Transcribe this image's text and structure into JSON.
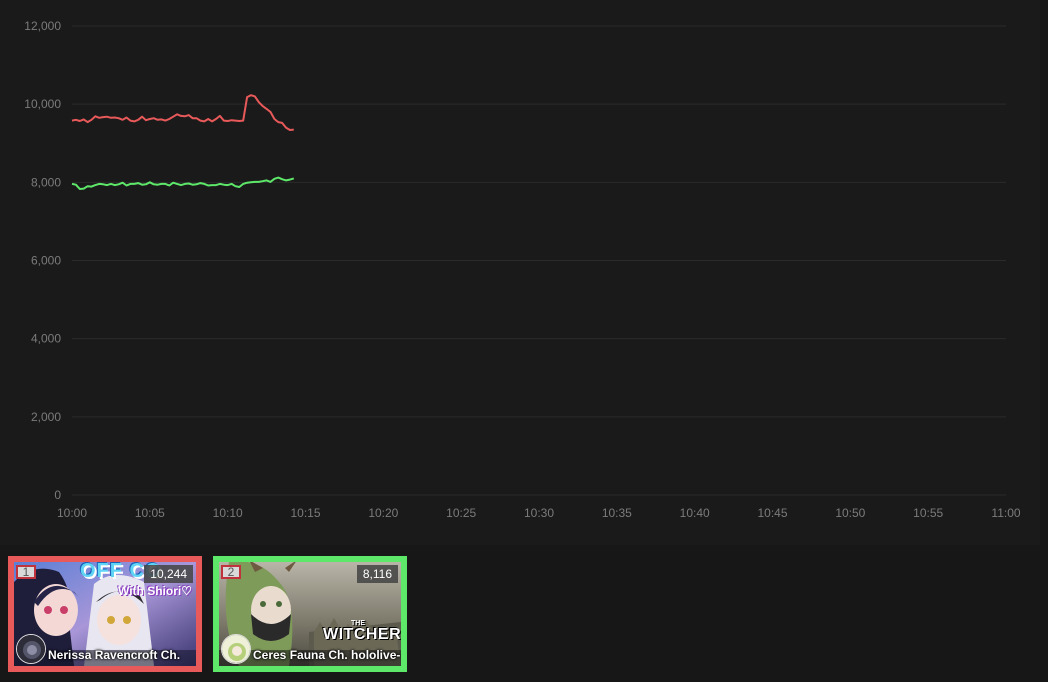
{
  "chart_data": {
    "type": "line",
    "title": "",
    "xlabel": "",
    "ylabel": "",
    "ylim": [
      0,
      12000
    ],
    "yticks": [
      "0",
      "2,000",
      "4,000",
      "6,000",
      "8,000",
      "10,000",
      "12,000"
    ],
    "xticks": [
      "10:00",
      "10:05",
      "10:10",
      "10:15",
      "10:20",
      "10:25",
      "10:30",
      "10:35",
      "10:40",
      "10:45",
      "10:50",
      "10:55",
      "11:00"
    ],
    "grid": true,
    "series": [
      {
        "color": "#e8595a",
        "points": [
          [
            0,
            9580
          ],
          [
            0.25,
            9600
          ],
          [
            0.5,
            9570
          ],
          [
            0.75,
            9610
          ],
          [
            1,
            9540
          ],
          [
            1.25,
            9600
          ],
          [
            1.5,
            9690
          ],
          [
            1.75,
            9650
          ],
          [
            2,
            9670
          ],
          [
            2.25,
            9680
          ],
          [
            2.5,
            9650
          ],
          [
            2.75,
            9660
          ],
          [
            3,
            9640
          ],
          [
            3.25,
            9600
          ],
          [
            3.5,
            9660
          ],
          [
            3.75,
            9580
          ],
          [
            4,
            9560
          ],
          [
            4.25,
            9600
          ],
          [
            4.5,
            9680
          ],
          [
            4.75,
            9590
          ],
          [
            5,
            9620
          ],
          [
            5.25,
            9640
          ],
          [
            5.5,
            9600
          ],
          [
            5.75,
            9610
          ],
          [
            6,
            9580
          ],
          [
            6.25,
            9620
          ],
          [
            6.5,
            9680
          ],
          [
            6.75,
            9740
          ],
          [
            7,
            9700
          ],
          [
            7.25,
            9690
          ],
          [
            7.5,
            9720
          ],
          [
            7.75,
            9640
          ],
          [
            8,
            9640
          ],
          [
            8.25,
            9580
          ],
          [
            8.5,
            9560
          ],
          [
            8.75,
            9620
          ],
          [
            9,
            9560
          ],
          [
            9.25,
            9620
          ],
          [
            9.5,
            9700
          ],
          [
            9.75,
            9580
          ],
          [
            10,
            9570
          ],
          [
            10.25,
            9590
          ],
          [
            10.5,
            9580
          ],
          [
            10.75,
            9570
          ],
          [
            11,
            9580
          ],
          [
            11.25,
            10180
          ],
          [
            11.5,
            10230
          ],
          [
            11.75,
            10200
          ],
          [
            12,
            10050
          ],
          [
            12.25,
            9950
          ],
          [
            12.5,
            9880
          ],
          [
            12.75,
            9800
          ],
          [
            13,
            9620
          ],
          [
            13.25,
            9540
          ],
          [
            13.5,
            9520
          ],
          [
            13.75,
            9400
          ],
          [
            14,
            9340
          ],
          [
            14.25,
            9350
          ]
        ]
      },
      {
        "color": "#5ee86a",
        "points": [
          [
            0,
            7960
          ],
          [
            0.25,
            7940
          ],
          [
            0.5,
            7830
          ],
          [
            0.75,
            7840
          ],
          [
            1,
            7900
          ],
          [
            1.25,
            7890
          ],
          [
            1.5,
            7930
          ],
          [
            1.75,
            7960
          ],
          [
            2,
            7950
          ],
          [
            2.25,
            7930
          ],
          [
            2.5,
            7960
          ],
          [
            2.75,
            7930
          ],
          [
            3,
            7950
          ],
          [
            3.25,
            7990
          ],
          [
            3.5,
            7920
          ],
          [
            3.75,
            7960
          ],
          [
            4,
            7960
          ],
          [
            4.25,
            7980
          ],
          [
            4.5,
            7940
          ],
          [
            4.75,
            7950
          ],
          [
            5,
            8000
          ],
          [
            5.25,
            7950
          ],
          [
            5.5,
            7940
          ],
          [
            5.75,
            7960
          ],
          [
            6,
            7960
          ],
          [
            6.25,
            7920
          ],
          [
            6.5,
            7990
          ],
          [
            6.75,
            7960
          ],
          [
            7,
            7930
          ],
          [
            7.25,
            7960
          ],
          [
            7.5,
            7970
          ],
          [
            7.75,
            7940
          ],
          [
            8,
            7950
          ],
          [
            8.25,
            7980
          ],
          [
            8.5,
            7960
          ],
          [
            8.75,
            7920
          ],
          [
            9,
            7930
          ],
          [
            9.25,
            7930
          ],
          [
            9.5,
            7960
          ],
          [
            9.75,
            7940
          ],
          [
            10,
            7930
          ],
          [
            10.25,
            7960
          ],
          [
            10.5,
            7900
          ],
          [
            10.75,
            7880
          ],
          [
            11,
            7960
          ],
          [
            11.25,
            7990
          ],
          [
            11.5,
            8000
          ],
          [
            11.75,
            8010
          ],
          [
            12,
            8010
          ],
          [
            12.25,
            8030
          ],
          [
            12.5,
            8050
          ],
          [
            12.75,
            8010
          ],
          [
            13,
            8090
          ],
          [
            13.25,
            8120
          ],
          [
            13.5,
            8080
          ],
          [
            13.75,
            8050
          ],
          [
            14,
            8070
          ],
          [
            14.25,
            8100
          ]
        ]
      }
    ]
  },
  "cards": [
    {
      "rank": "1",
      "viewers": "10,244",
      "channel": "Nerissa Ravencroft Ch.",
      "thumb_text": "OFF CO",
      "thumb_subtext": "With Shiori♡",
      "border_color": "#e8595a"
    },
    {
      "rank": "2",
      "viewers": "8,116",
      "channel": "Ceres Fauna Ch. hololive-",
      "thumb_text": "WITCHER",
      "thumb_subtext": "THE",
      "border_color": "#5ee86a"
    }
  ]
}
